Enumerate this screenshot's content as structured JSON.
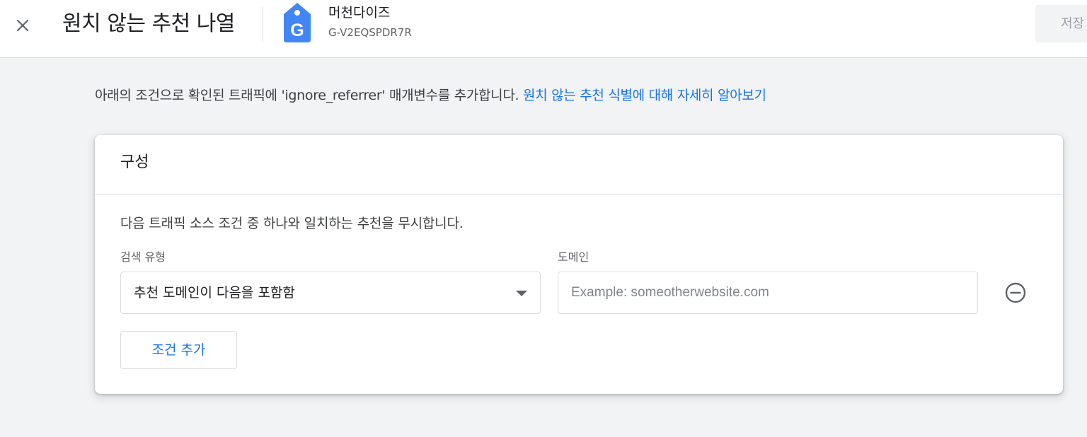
{
  "header": {
    "title": "원치 않는 추천 나열",
    "property_name": "머천다이즈",
    "property_id": "G-V2EQSPDR7R",
    "save_label": "저장"
  },
  "intro": {
    "text": "아래의 조건으로 확인된 트래픽에 'ignore_referrer' 매개변수를 추가합니다. ",
    "link_label": "원치 않는 추천 식별에 대해 자세히 알아보기"
  },
  "card": {
    "title": "구성",
    "description": "다음 트래픽 소스 조건 중 하나와 일치하는 추천을 무시합니다.",
    "match_type_label": "검색 유형",
    "match_type_value": "추천 도메인이 다음을 포함함",
    "domain_label": "도메인",
    "domain_value": "",
    "domain_placeholder": "Example: someotherwebsite.com",
    "add_condition_label": "조건 추가"
  },
  "colors": {
    "accent": "#1a73e8",
    "background": "#f1f3f4",
    "brand_tag": "#4285f4"
  },
  "icons": {
    "close": "close-icon",
    "property": "google-tag-icon",
    "dropdown": "caret-down-icon",
    "remove": "remove-circle-icon"
  }
}
